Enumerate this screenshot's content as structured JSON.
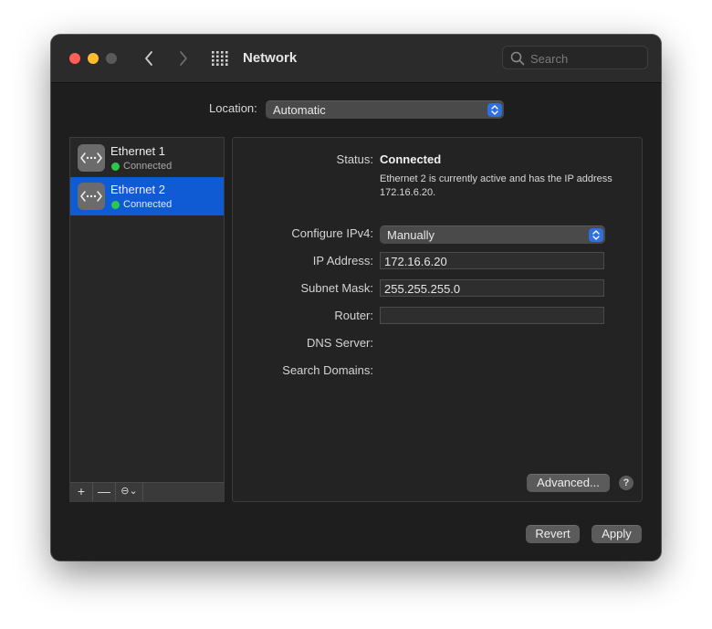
{
  "window": {
    "title": "Network",
    "search_placeholder": "Search"
  },
  "location": {
    "label": "Location:",
    "value": "Automatic"
  },
  "services": [
    {
      "name": "Ethernet 1",
      "status": "Connected",
      "selected": false
    },
    {
      "name": "Ethernet 2",
      "status": "Connected",
      "selected": true
    }
  ],
  "sidebar_toolbar": {
    "add": "+",
    "remove": "—",
    "action": "⊖⌄"
  },
  "detail": {
    "status_label": "Status:",
    "status_value": "Connected",
    "status_description": "Ethernet 2 is currently active and has the IP address 172.16.6.20.",
    "configure_label": "Configure IPv4:",
    "configure_value": "Manually",
    "ip_label": "IP Address:",
    "ip_value": "172.16.6.20",
    "subnet_label": "Subnet Mask:",
    "subnet_value": "255.255.255.0",
    "router_label": "Router:",
    "router_value": "",
    "dns_label": "DNS Server:",
    "search_domains_label": "Search Domains:",
    "advanced_label": "Advanced...",
    "help_label": "?"
  },
  "footer": {
    "revert_label": "Revert",
    "apply_label": "Apply"
  },
  "colors": {
    "accent": "#0f5bd3",
    "connected": "#2cc84a",
    "close": "#fe5f57",
    "minimize": "#febc2e"
  }
}
